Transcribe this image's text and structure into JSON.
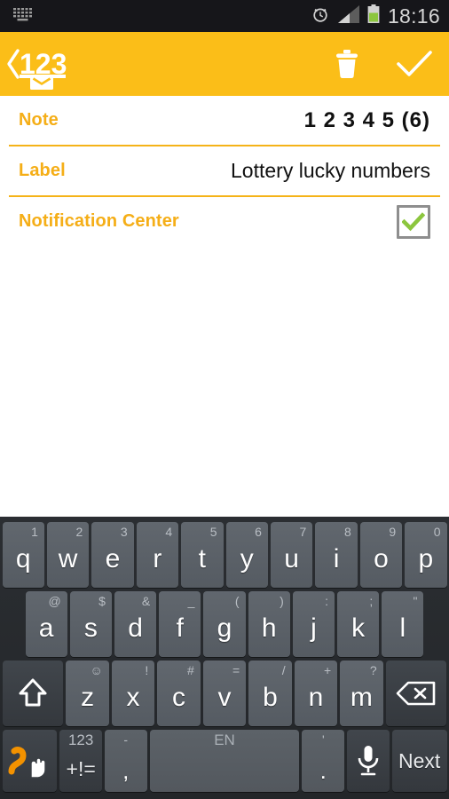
{
  "status_bar": {
    "input_method_icon": "keyboard-icon",
    "alarm_icon": "alarm-clock-icon",
    "signal_icon": "signal-bars-icon",
    "battery_icon": "battery-icon",
    "time": "18:16",
    "colors": {
      "background": "#16161a",
      "text": "#d6d6d6",
      "battery_fill": "#8cc63e"
    }
  },
  "app_bar": {
    "up_icon": "back-chevron-icon",
    "app_logo_text": "123",
    "app_logo_badge_icon": "envelope-badge-icon",
    "delete_icon": "trash-icon",
    "confirm_icon": "checkmark-icon",
    "colors": {
      "background": "#fbbe18",
      "foreground": "#ffffff"
    }
  },
  "form": {
    "rows": [
      {
        "label": "Note",
        "value": "1 2 3 4 5 (6)",
        "type": "text-bold"
      },
      {
        "label": "Label",
        "value": "Lottery lucky numbers",
        "type": "text"
      },
      {
        "label": "Notification Center",
        "value": "",
        "type": "checkbox",
        "checked": true
      }
    ],
    "colors": {
      "label": "#f5ae17",
      "value": "#111111",
      "divider": "#f5b318",
      "checkbox_border": "#8e8e8e",
      "checkbox_tick": "#8cc63e"
    }
  },
  "keyboard": {
    "language_hint": "EN",
    "rows": [
      {
        "name": "row-1",
        "keys": [
          {
            "main": "q",
            "alt": "1"
          },
          {
            "main": "w",
            "alt": "2"
          },
          {
            "main": "e",
            "alt": "3"
          },
          {
            "main": "r",
            "alt": "4"
          },
          {
            "main": "t",
            "alt": "5"
          },
          {
            "main": "y",
            "alt": "6"
          },
          {
            "main": "u",
            "alt": "7"
          },
          {
            "main": "i",
            "alt": "8"
          },
          {
            "main": "o",
            "alt": "9"
          },
          {
            "main": "p",
            "alt": "0"
          }
        ]
      },
      {
        "name": "row-2",
        "keys": [
          {
            "main": "a",
            "alt": "@"
          },
          {
            "main": "s",
            "alt": "$"
          },
          {
            "main": "d",
            "alt": "&"
          },
          {
            "main": "f",
            "alt": "_"
          },
          {
            "main": "g",
            "alt": "("
          },
          {
            "main": "h",
            "alt": ")"
          },
          {
            "main": "j",
            "alt": ":"
          },
          {
            "main": "k",
            "alt": ";"
          },
          {
            "main": "l",
            "alt": "\""
          }
        ]
      },
      {
        "name": "row-3",
        "shift_icon": "shift-arrow-icon",
        "backspace_icon": "backspace-icon",
        "keys": [
          {
            "main": "z",
            "alt": "☺"
          },
          {
            "main": "x",
            "alt": "!"
          },
          {
            "main": "c",
            "alt": "#"
          },
          {
            "main": "v",
            "alt": "="
          },
          {
            "main": "b",
            "alt": "/"
          },
          {
            "main": "n",
            "alt": "+"
          },
          {
            "main": "m",
            "alt": "?"
          }
        ]
      },
      {
        "name": "row-4",
        "swipe_icon": "swipe-gesture-icon",
        "symbols_alt": "123",
        "symbols_main": "+!=",
        "comma_alt": "-",
        "comma_main": ",",
        "space_label": "EN",
        "period_alt": "'",
        "period_main": ".",
        "mic_icon": "microphone-icon",
        "enter_label": "Next"
      }
    ],
    "colors": {
      "background": "#2b2f33",
      "key_face": "#5c6268",
      "key_dark": "#3a3f44",
      "key_text": "#ffffff",
      "alt_text": "#b9bec4",
      "swipe_accent": "#f39200"
    }
  }
}
